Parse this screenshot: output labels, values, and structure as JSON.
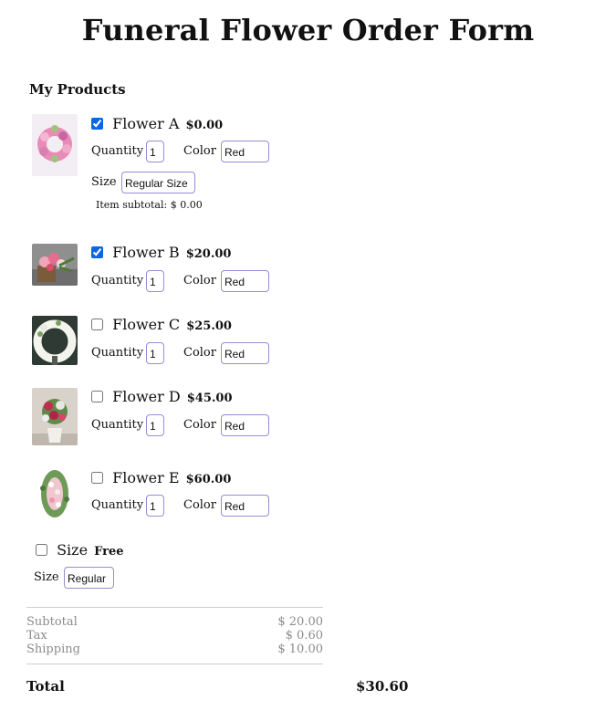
{
  "form": {
    "title": "Funeral Flower Order Form",
    "section_title": "My Products"
  },
  "products": [
    {
      "name": "Flower A",
      "price": "$0.00",
      "checked": true,
      "quantity_label": "Quantity",
      "quantity": "1",
      "color_label": "Color",
      "color": "Red",
      "size_label": "Size",
      "size": "Regular Size",
      "item_subtotal": "Item subtotal: $ 0.00"
    },
    {
      "name": "Flower B",
      "price": "$20.00",
      "checked": true,
      "quantity_label": "Quantity",
      "quantity": "1",
      "color_label": "Color",
      "color": "Red"
    },
    {
      "name": "Flower C",
      "price": "$25.00",
      "checked": false,
      "quantity_label": "Quantity",
      "quantity": "1",
      "color_label": "Color",
      "color": "Red"
    },
    {
      "name": "Flower D",
      "price": "$45.00",
      "checked": false,
      "quantity_label": "Quantity",
      "quantity": "1",
      "color_label": "Color",
      "color": "Red"
    },
    {
      "name": "Flower E",
      "price": "$60.00",
      "checked": false,
      "quantity_label": "Quantity",
      "quantity": "1",
      "color_label": "Color",
      "color": "Red"
    }
  ],
  "size_option": {
    "name": "Size",
    "price": "Free",
    "checked": false,
    "size_label": "Size",
    "size": "Regular"
  },
  "summary": {
    "subtotal_label": "Subtotal",
    "subtotal": "$ 20.00",
    "tax_label": "Tax",
    "tax": "$ 0.60",
    "shipping_label": "Shipping",
    "shipping": "$ 10.00",
    "total_label": "Total",
    "total": "$30.60"
  },
  "colors": {
    "input_border": "#9b8bd1",
    "checkbox_accent": "#0a66e8",
    "muted_text": "#8c8c8c"
  }
}
